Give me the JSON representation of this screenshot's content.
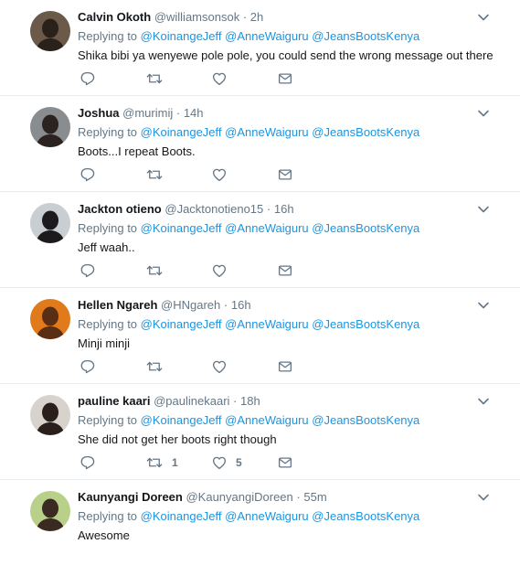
{
  "colors": {
    "link": "#1b95e0",
    "muted": "#657786",
    "text": "#14171a",
    "divider": "#e6ecf0"
  },
  "tweets": [
    {
      "name": "Calvin Okoth",
      "handle": "@williamsonsok",
      "time": "2h",
      "replying_prefix": "Replying to",
      "mentions": [
        "@KoinangeJeff",
        "@AnneWaiguru",
        "@JeansBootsKenya"
      ],
      "text": "Shika bibi ya wenyewe pole pole, you could send the wrong message out there",
      "retweets": "",
      "likes": "",
      "avatar": {
        "bg": "#6b5a4a",
        "fg": "#2b211b"
      }
    },
    {
      "name": "Joshua",
      "handle": "@murimij",
      "time": "14h",
      "replying_prefix": "Replying to",
      "mentions": [
        "@KoinangeJeff",
        "@AnneWaiguru",
        "@JeansBootsKenya"
      ],
      "text": "Boots...I repeat Boots.",
      "retweets": "",
      "likes": "",
      "avatar": {
        "bg": "#8a8d90",
        "fg": "#2c2220"
      }
    },
    {
      "name": "Jackton otieno",
      "handle": "@Jacktonotieno15",
      "time": "16h",
      "replying_prefix": "Replying to",
      "mentions": [
        "@KoinangeJeff",
        "@AnneWaiguru",
        "@JeansBootsKenya"
      ],
      "text": "Jeff waah..",
      "retweets": "",
      "likes": "",
      "avatar": {
        "bg": "#c9ced3",
        "fg": "#1c1a1c"
      }
    },
    {
      "name": "Hellen Ngareh",
      "handle": "@HNgareh",
      "time": "16h",
      "replying_prefix": "Replying to",
      "mentions": [
        "@KoinangeJeff",
        "@AnneWaiguru",
        "@JeansBootsKenya"
      ],
      "text": "Minji minji",
      "retweets": "",
      "likes": "",
      "avatar": {
        "bg": "#e07a1a",
        "fg": "#5a2e14"
      }
    },
    {
      "name": "pauline kaari",
      "handle": "@paulinekaari",
      "time": "18h",
      "replying_prefix": "Replying to",
      "mentions": [
        "@KoinangeJeff",
        "@AnneWaiguru",
        "@JeansBootsKenya"
      ],
      "text": "She did not get her boots right though",
      "retweets": "1",
      "likes": "5",
      "avatar": {
        "bg": "#d8d2cc",
        "fg": "#2a1f1a"
      }
    },
    {
      "name": "Kaunyangi Doreen",
      "handle": "@KaunyangiDoreen",
      "time": "55m",
      "replying_prefix": "Replying to",
      "mentions": [
        "@KoinangeJeff",
        "@AnneWaiguru",
        "@JeansBootsKenya"
      ],
      "text": "Awesome",
      "retweets": "",
      "likes": "",
      "avatar": {
        "bg": "#b9d08a",
        "fg": "#3a2a22"
      }
    }
  ]
}
